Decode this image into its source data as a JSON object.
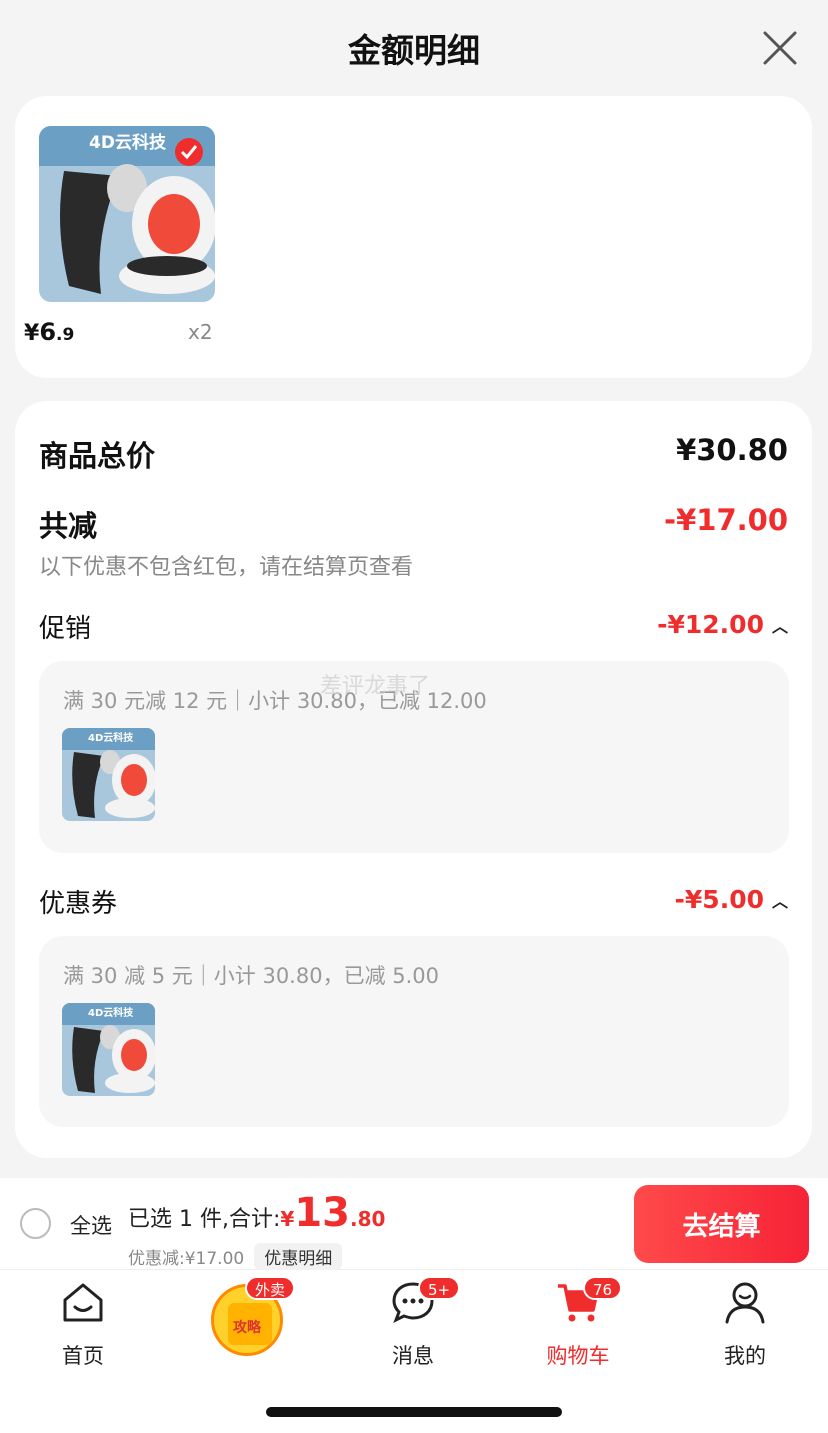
{
  "header": {
    "title": "金额明细"
  },
  "product": {
    "price_symbol": "¥",
    "price_int": "6",
    "price_dec": ".9",
    "qty": "x2"
  },
  "detail": {
    "total_label": "商品总价",
    "total_value": "¥30.80",
    "reduce_label": "共减",
    "reduce_value": "-¥17.00",
    "note": "以下优惠不包含红包，请在结算页查看",
    "promo_label": "促销",
    "promo_value": "-¥12.00",
    "promo_desc": "满 30 元减 12 元｜小计 30.80，已减 12.00",
    "coupon_label": "优惠券",
    "coupon_value": "-¥5.00",
    "coupon_desc": "满 30 减 5 元｜小计 30.80，已减 5.00"
  },
  "watermark": "差评龙事了",
  "footer": {
    "select_all": "全选",
    "summary_prefix": "已选 1 件,合计:",
    "total_yen": "¥",
    "total_int": "13",
    "total_dec": ".80",
    "discount": "优惠减:¥17.00",
    "detail_chip": "优惠明细",
    "checkout": "去结算"
  },
  "tabbar": {
    "home": "首页",
    "promo_badge": "外卖",
    "promo_text": "攻略",
    "messages": "消息",
    "messages_badge": "5+",
    "cart": "购物车",
    "cart_badge": "76",
    "me": "我的"
  },
  "colors": {
    "accent": "#f02d2d"
  }
}
